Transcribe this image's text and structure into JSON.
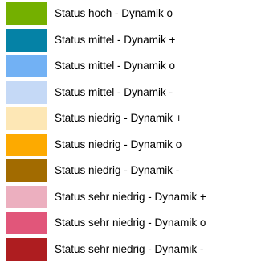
{
  "legend": {
    "items": [
      {
        "label": "Status hoch - Dynamik o",
        "color": "#74b000"
      },
      {
        "label": "Status mittel - Dynamik +",
        "color": "#0582a6"
      },
      {
        "label": "Status mittel - Dynamik o",
        "color": "#72b1f4"
      },
      {
        "label": "Status mittel - Dynamik -",
        "color": "#c5d9f6"
      },
      {
        "label": "Status niedrig - Dynamik +",
        "color": "#fde7b5"
      },
      {
        "label": "Status niedrig - Dynamik o",
        "color": "#fdaa00"
      },
      {
        "label": "Status niedrig - Dynamik -",
        "color": "#a26b00"
      },
      {
        "label": "Status sehr niedrig - Dynamik +",
        "color": "#ecafbf"
      },
      {
        "label": "Status sehr niedrig - Dynamik o",
        "color": "#e1567a"
      },
      {
        "label": "Status sehr niedrig - Dynamik -",
        "color": "#ae1d20"
      }
    ]
  }
}
